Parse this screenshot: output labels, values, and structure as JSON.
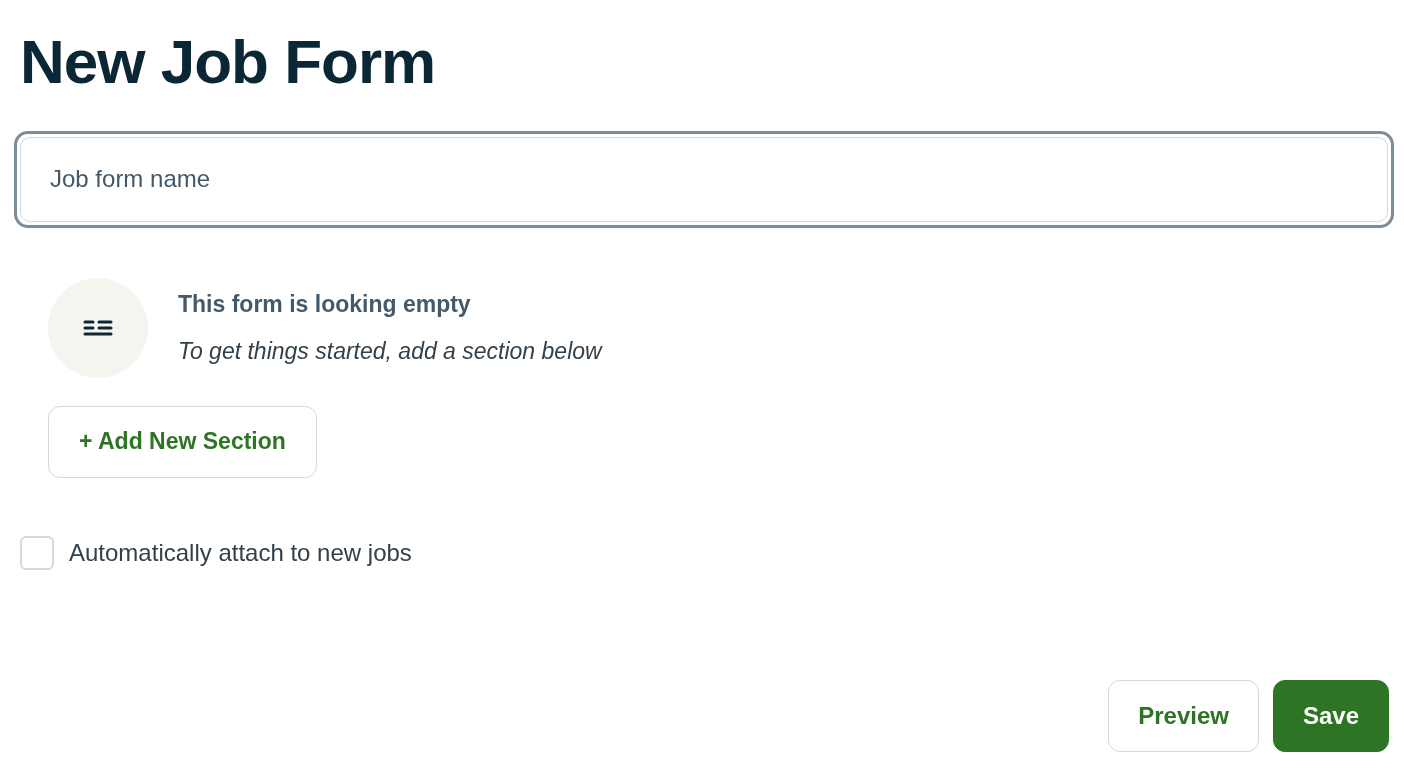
{
  "title": "New Job Form",
  "name_field": {
    "placeholder": "Job form name",
    "focused": true
  },
  "empty_state": {
    "heading": "This form is looking empty",
    "hint": "To get things started, add a section below"
  },
  "add_section_button": "+ Add New Section",
  "auto_attach": {
    "label": "Automatically attach to new jobs",
    "checked": false
  },
  "footer_buttons": [
    {
      "label": "Preview",
      "kind": "secondary"
    },
    {
      "label": "Save",
      "kind": "primary"
    }
  ]
}
